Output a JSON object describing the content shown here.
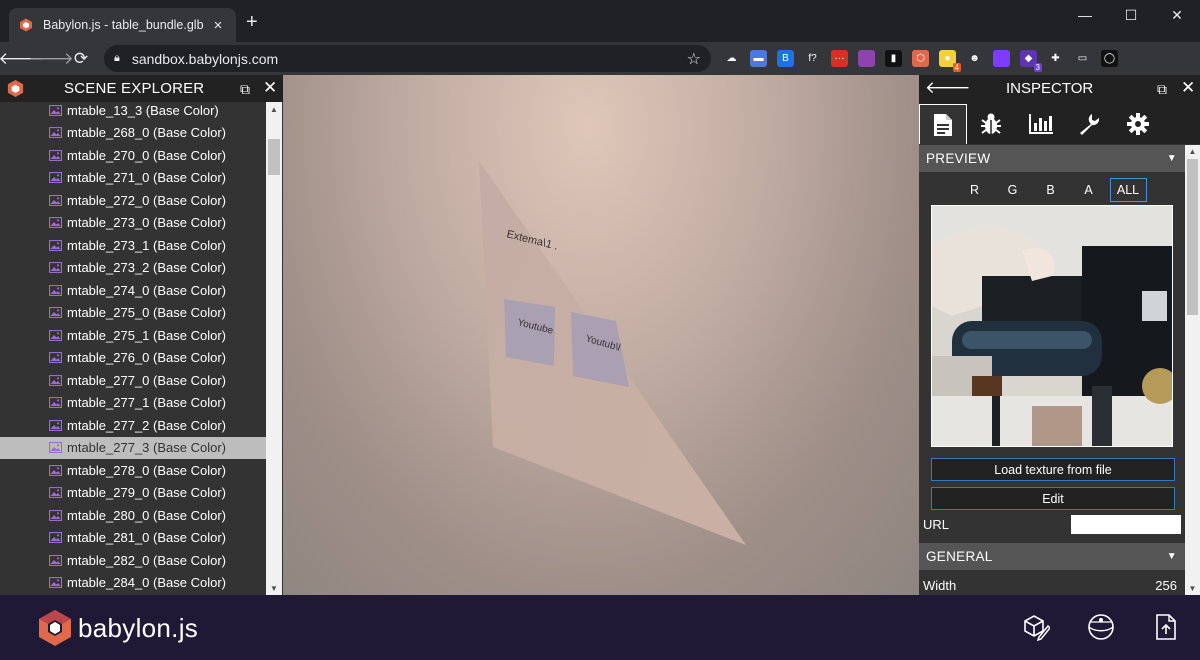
{
  "browser": {
    "tab_title": "Babylon.js - table_bundle.glb",
    "tab_close": "×",
    "new_tab": "+",
    "url": "sandbox.babylonjs.com",
    "window_controls": [
      "—",
      "☐",
      "✕"
    ],
    "extensions": [
      {
        "icon": "cloud-icon",
        "color": "#35363a",
        "glyph": "☁",
        "badge": ""
      },
      {
        "icon": "chat-icon",
        "color": "#4a7bd6",
        "glyph": "▬",
        "badge": ""
      },
      {
        "icon": "grid-icon",
        "color": "#1a73e8",
        "glyph": "B",
        "badge": ""
      },
      {
        "icon": "function-icon",
        "color": "#35363a",
        "glyph": "f?",
        "badge": ""
      },
      {
        "icon": "dots-icon",
        "color": "#d93025",
        "glyph": "···",
        "badge": ""
      },
      {
        "icon": "gradient-icon",
        "color": "#8e44ad",
        "glyph": "",
        "badge": ""
      },
      {
        "icon": "book-icon",
        "color": "#111111",
        "glyph": "▮",
        "badge": ""
      },
      {
        "icon": "babylon-ext-icon",
        "color": "#e0684b",
        "glyph": "⬡",
        "badge": ""
      },
      {
        "icon": "bulb-icon",
        "color": "#f4d03f",
        "glyph": "●",
        "badge": "4"
      },
      {
        "icon": "panda-icon",
        "color": "#35363a",
        "glyph": "☻",
        "badge": ""
      },
      {
        "icon": "square-icon",
        "color": "#7d3cff",
        "glyph": "",
        "badge": ""
      },
      {
        "icon": "tag-icon",
        "color": "#5e35b1",
        "glyph": "◆",
        "badge": "3"
      },
      {
        "icon": "puzzle-icon",
        "color": "#35363a",
        "glyph": "✚",
        "badge": ""
      },
      {
        "icon": "cast-icon",
        "color": "#35363a",
        "glyph": "▭",
        "badge": ""
      },
      {
        "icon": "profile-icon",
        "color": "#111111",
        "glyph": "◯",
        "badge": ""
      }
    ]
  },
  "explorer": {
    "title": "SCENE EXPLORER",
    "items": [
      "mtable_13_3 (Base Color)",
      "mtable_268_0 (Base Color)",
      "mtable_270_0 (Base Color)",
      "mtable_271_0 (Base Color)",
      "mtable_272_0 (Base Color)",
      "mtable_273_0 (Base Color)",
      "mtable_273_1 (Base Color)",
      "mtable_273_2 (Base Color)",
      "mtable_274_0 (Base Color)",
      "mtable_275_0 (Base Color)",
      "mtable_275_1 (Base Color)",
      "mtable_276_0 (Base Color)",
      "mtable_277_0 (Base Color)",
      "mtable_277_1 (Base Color)",
      "mtable_277_2 (Base Color)",
      "mtable_277_3 (Base Color)",
      "mtable_278_0 (Base Color)",
      "mtable_279_0 (Base Color)",
      "mtable_280_0 (Base Color)",
      "mtable_281_0 (Base Color)",
      "mtable_282_0 (Base Color)",
      "mtable_284_0 (Base Color)"
    ],
    "selected_index": 15
  },
  "viewport": {
    "labels": [
      "Extema\\1 .",
      "Youtube",
      "Youtub\\l"
    ]
  },
  "inspector": {
    "title": "INSPECTOR",
    "tabs": [
      "properties",
      "debug",
      "statistics",
      "tools",
      "settings"
    ],
    "preview_section": "PREVIEW",
    "channels": [
      "R",
      "G",
      "B",
      "A",
      "ALL"
    ],
    "active_channel": "ALL",
    "load_button": "Load texture from file",
    "edit_button": "Edit",
    "url_label": "URL",
    "url_value": "",
    "general_section": "GENERAL",
    "width_label": "Width",
    "width_value": "256"
  },
  "footer": {
    "brand": "babylon.js"
  }
}
